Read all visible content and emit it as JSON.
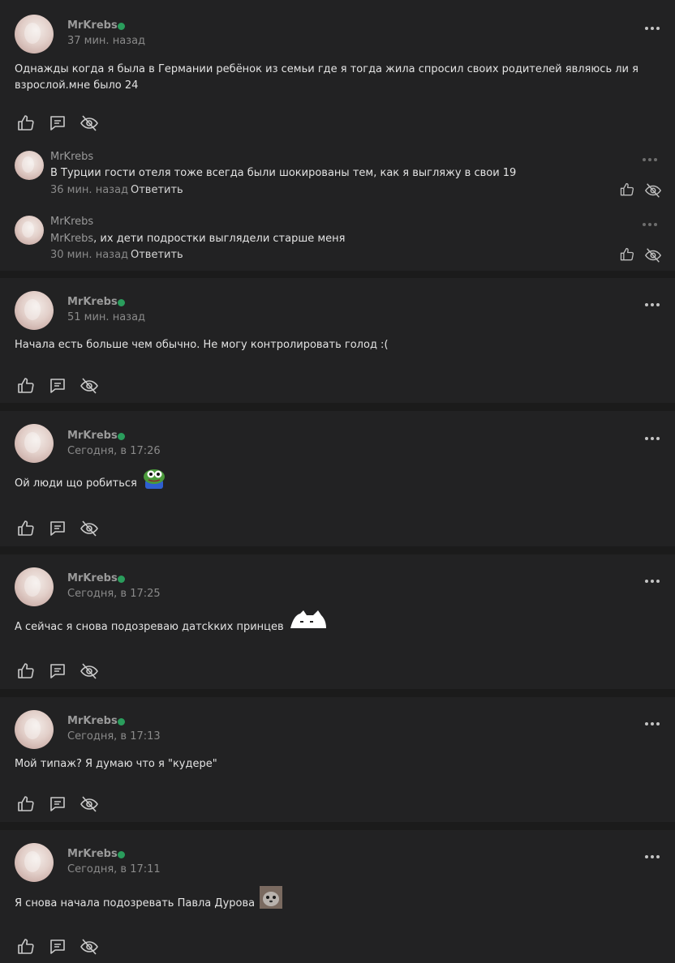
{
  "posts": [
    {
      "author": "MrKrebs",
      "time": "37 мин. назад",
      "text": "Однажды когда я была в Германии ребёнок из семьи где я тогда жила спросил своих родителей являюсь ли я взрослой.мне было 24",
      "replies": [
        {
          "author": "MrKrebs",
          "text": "В Турции гости отеля тоже всегда были шокированы тем, как я выгляжу в свои 19",
          "time": "36 мин. назад",
          "reply_label": "Ответить"
        },
        {
          "author": "MrKrebs",
          "mention": "MrKrebs",
          "text": ", их дети подростки выглядели старше меня",
          "time": "30 мин. назад",
          "reply_label": "Ответить"
        }
      ]
    },
    {
      "author": "MrKrebs",
      "time": "51 мин. назад",
      "text": "Начала есть больше чем обычно. Не могу контролировать голод :("
    },
    {
      "author": "MrKrebs",
      "time": "Сегодня, в 17:26",
      "text": "Ой люди що робиться",
      "emoji": "pepe-frog-sticker"
    },
    {
      "author": "MrKrebs",
      "time": "Сегодня, в 17:25",
      "text": "А сейчас я снова подозреваю датсkких принцев",
      "emoji": "white-cat-sticker"
    },
    {
      "author": "MrKrebs",
      "time": "Сегодня, в 17:13",
      "text": "Мой типаж? Я думаю что я \"кудере\""
    },
    {
      "author": "MrKrebs",
      "time": "Сегодня, в 17:11",
      "text": "Я снова начала подозревать Павла Дурова",
      "emoji": "seal-photo-sticker"
    }
  ],
  "colors": {
    "background": "#1b1b1b",
    "card": "#222223",
    "online": "#2a9d5c",
    "muted": "#8a8a8a"
  },
  "icons": [
    "thumbs-up-icon",
    "comment-icon",
    "eye-off-icon",
    "more-icon"
  ]
}
